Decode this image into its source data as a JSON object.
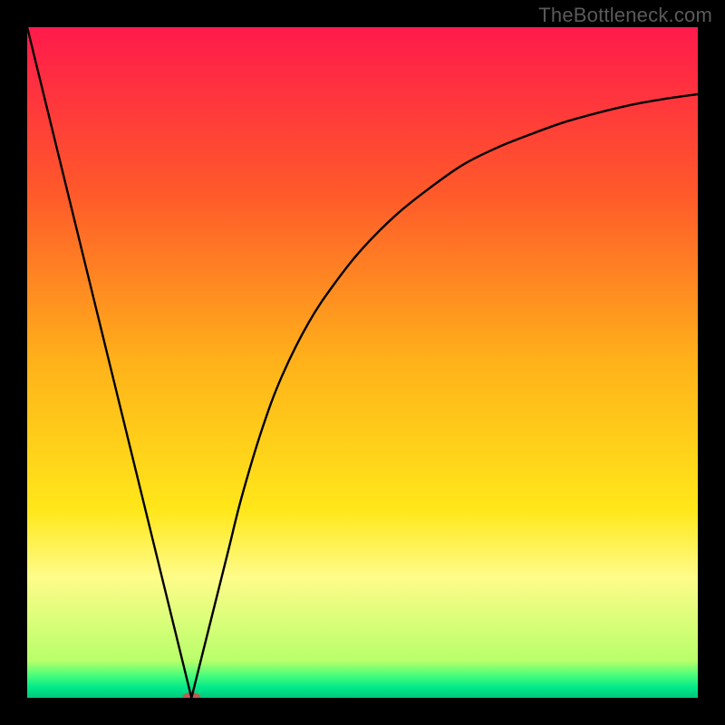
{
  "watermark": "TheBottleneck.com",
  "chart_data": {
    "type": "line",
    "title": "",
    "xlabel": "",
    "ylabel": "",
    "xlim": [
      0,
      100
    ],
    "ylim": [
      0,
      100
    ],
    "grid": false,
    "background_gradient": {
      "stops": [
        {
          "offset": 0.0,
          "color": "#ff1a4b"
        },
        {
          "offset": 0.25,
          "color": "#ff5a2a"
        },
        {
          "offset": 0.5,
          "color": "#ffb21a"
        },
        {
          "offset": 0.72,
          "color": "#ffe71a"
        },
        {
          "offset": 0.82,
          "color": "#fffc8a"
        },
        {
          "offset": 0.945,
          "color": "#b8ff6a"
        },
        {
          "offset": 0.965,
          "color": "#4fff7a"
        },
        {
          "offset": 0.985,
          "color": "#00e88a"
        },
        {
          "offset": 1.0,
          "color": "#00c97a"
        }
      ]
    },
    "series": [
      {
        "name": "left-branch",
        "x": [
          0,
          24.5
        ],
        "y": [
          100,
          0
        ]
      },
      {
        "name": "right-branch",
        "x": [
          24.5,
          26,
          28,
          30,
          32,
          35,
          38,
          42,
          46,
          50,
          55,
          60,
          65,
          70,
          75,
          80,
          85,
          90,
          95,
          100
        ],
        "y": [
          0,
          6,
          14,
          22,
          30,
          40,
          48,
          56,
          62,
          67,
          72,
          76,
          79.5,
          82,
          84,
          85.8,
          87.2,
          88.4,
          89.3,
          90
        ]
      }
    ],
    "marker": {
      "label": "minimum-marker",
      "x": 24.5,
      "y": 0,
      "rx": 10,
      "ry": 6,
      "fill": "#c05a55"
    }
  }
}
